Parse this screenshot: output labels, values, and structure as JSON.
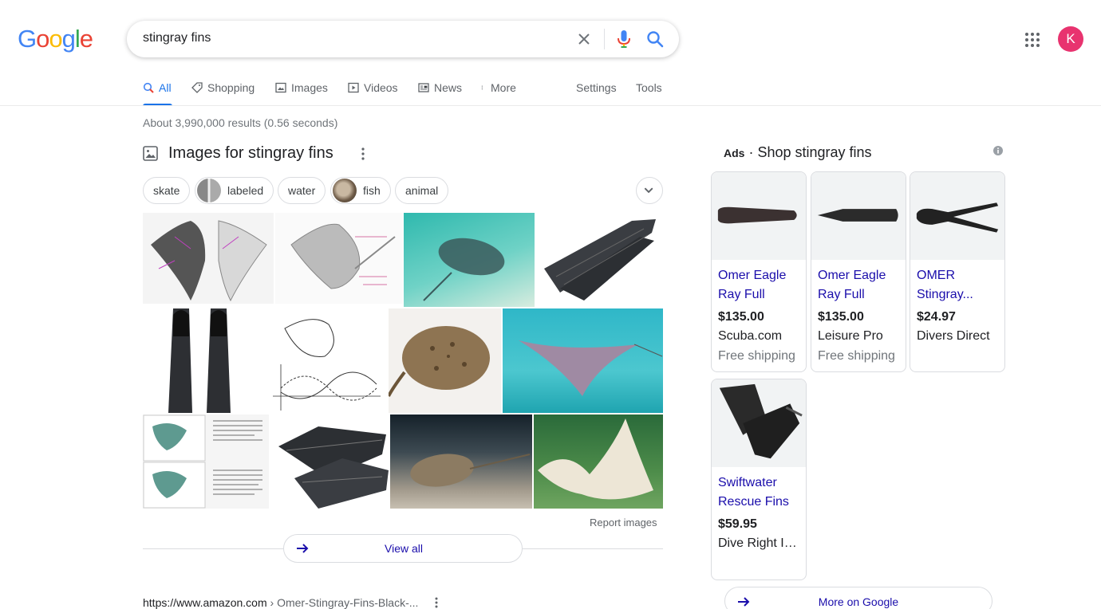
{
  "header": {
    "logo_letters": [
      "G",
      "o",
      "o",
      "g",
      "l",
      "e"
    ],
    "search_value": "stingray fins",
    "avatar_letter": "K"
  },
  "colors": {
    "google_blue": "#4285f4",
    "google_red": "#ea4335",
    "google_yellow": "#fbbc05",
    "google_green": "#34a853",
    "link": "#1a0dab",
    "active_tab": "#1a73e8",
    "avatar": "#e8336f"
  },
  "tabs": {
    "all": "All",
    "shopping": "Shopping",
    "images": "Images",
    "videos": "Videos",
    "news": "News",
    "more": "More",
    "settings": "Settings",
    "tools": "Tools"
  },
  "result_stats": "About 3,990,000 results (0.56 seconds)",
  "images_section": {
    "heading": "Images for stingray fins",
    "chips": [
      "skate",
      "labeled",
      "water",
      "fish",
      "animal"
    ],
    "report": "Report images",
    "view_all": "View all"
  },
  "organic": {
    "domain": "https://www.amazon.com",
    "path": " › Omer-Stingray-Fins-Black-..."
  },
  "ads": {
    "label": "Ads",
    "title": " · Shop stingray fins",
    "more": "More on Google",
    "products": [
      {
        "title": "Omer Eagle Ray Full Foo...",
        "price": "$135.00",
        "store": "Scuba.com",
        "shipping": "Free shipping"
      },
      {
        "title": "Omer Eagle Ray Full Foo...",
        "price": "$135.00",
        "store": "Leisure Pro",
        "shipping": "Free shipping"
      },
      {
        "title": "OMER Stingray...",
        "price": "$24.97",
        "store": "Divers Direct",
        "shipping": ""
      },
      {
        "title": "Swiftwater Rescue Fins ...",
        "price": "$59.95",
        "store": "Dive Right In...",
        "shipping": ""
      }
    ]
  }
}
